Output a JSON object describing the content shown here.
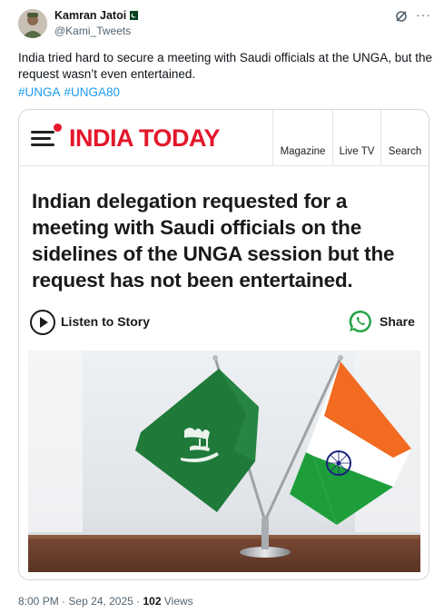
{
  "author": {
    "name": "Kamran Jatoi",
    "handle": "@Kami_Tweets"
  },
  "tweet": {
    "text": "India tried hard to secure a meeting with Saudi officials at the UNGA, but the request wasn’t even entertained.",
    "hashtags": [
      "#UNGA",
      "#UNGA80"
    ]
  },
  "article": {
    "brand": "INDIA TODAY",
    "nav": [
      "Magazine",
      "Live TV",
      "Search"
    ],
    "headline": "Indian delegation requested for a meeting with Saudi officials on the sidelines of the UNGA session but the request has not been entertained.",
    "listen_label": "Listen to Story",
    "share_label": "Share"
  },
  "footer": {
    "time": "8:00 PM",
    "date": "Sep 24, 2025",
    "separator": "·",
    "views_count": "102",
    "views_label": "Views"
  },
  "colors": {
    "brand_red": "#e4172b",
    "link_blue": "#1d9bf0",
    "saudi_green": "#1f7a3a",
    "saffron": "#f26b21",
    "india_green": "#1e9e3a",
    "chakra_navy": "#1a237e"
  },
  "icons": [
    "pakistan-flag-icon",
    "grok-icon",
    "more-icon",
    "hamburger-menu-icon",
    "play-icon",
    "whatsapp-icon"
  ]
}
